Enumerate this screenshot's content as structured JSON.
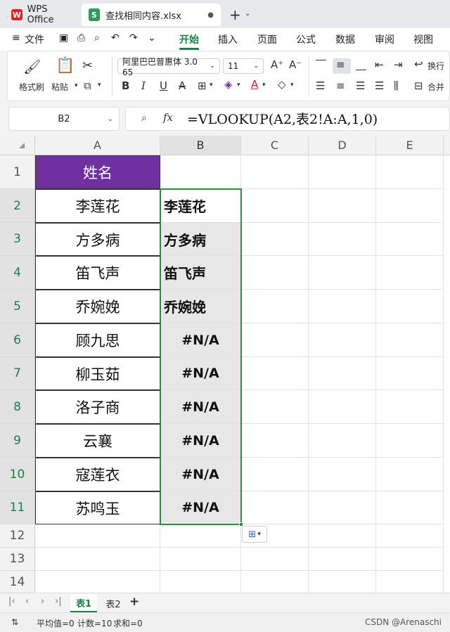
{
  "titlebar": {
    "app_tab": "WPS Office",
    "app_logo": "W",
    "doc_tab": "查找相同内容.xlsx",
    "doc_logo": "S",
    "doc_unsaved": "●",
    "new_tab": "+",
    "new_tab_arrow": "⌄"
  },
  "menubar": {
    "file_label": "文件",
    "items": [
      "开始",
      "插入",
      "页面",
      "公式",
      "数据",
      "审阅",
      "视图"
    ],
    "active_index": 0
  },
  "ribbon": {
    "format_painter": "格式刷",
    "paste": "粘贴",
    "font_name": "阿里巴巴普惠体 3.0 65",
    "font_size": "11",
    "wrap": "换行",
    "merge": "合并"
  },
  "formula_bar": {
    "cell_ref": "B2",
    "fx": "fx",
    "formula": "=VLOOKUP(A2,表2!A:A,1,0)"
  },
  "grid": {
    "columns": [
      "A",
      "B",
      "C",
      "D",
      "E"
    ],
    "rows": [
      "1",
      "2",
      "3",
      "4",
      "5",
      "6",
      "7",
      "8",
      "9",
      "10",
      "11",
      "12",
      "13",
      "14"
    ],
    "header_a1": "姓名",
    "colA": [
      "李莲花",
      "方多病",
      "笛飞声",
      "乔婉娩",
      "顾九思",
      "柳玉茹",
      "洛子商",
      "云襄",
      "寇莲衣",
      "苏鸣玉"
    ],
    "colB": [
      "李莲花",
      "方多病",
      "笛飞声",
      "乔婉娩",
      "#N/A",
      "#N/A",
      "#N/A",
      "#N/A",
      "#N/A",
      "#N/A"
    ]
  },
  "sheets": {
    "tabs": [
      "表1",
      "表2"
    ],
    "active_index": 0,
    "add": "+"
  },
  "status": {
    "average": "平均值=0",
    "count": "计数=10",
    "sum": "求和=0",
    "watermark": "CSDN @Arenaschi"
  },
  "colors": {
    "accent": "#1a7f4b",
    "header_fill": "#7030a0",
    "selection": "#2b8a3e"
  }
}
